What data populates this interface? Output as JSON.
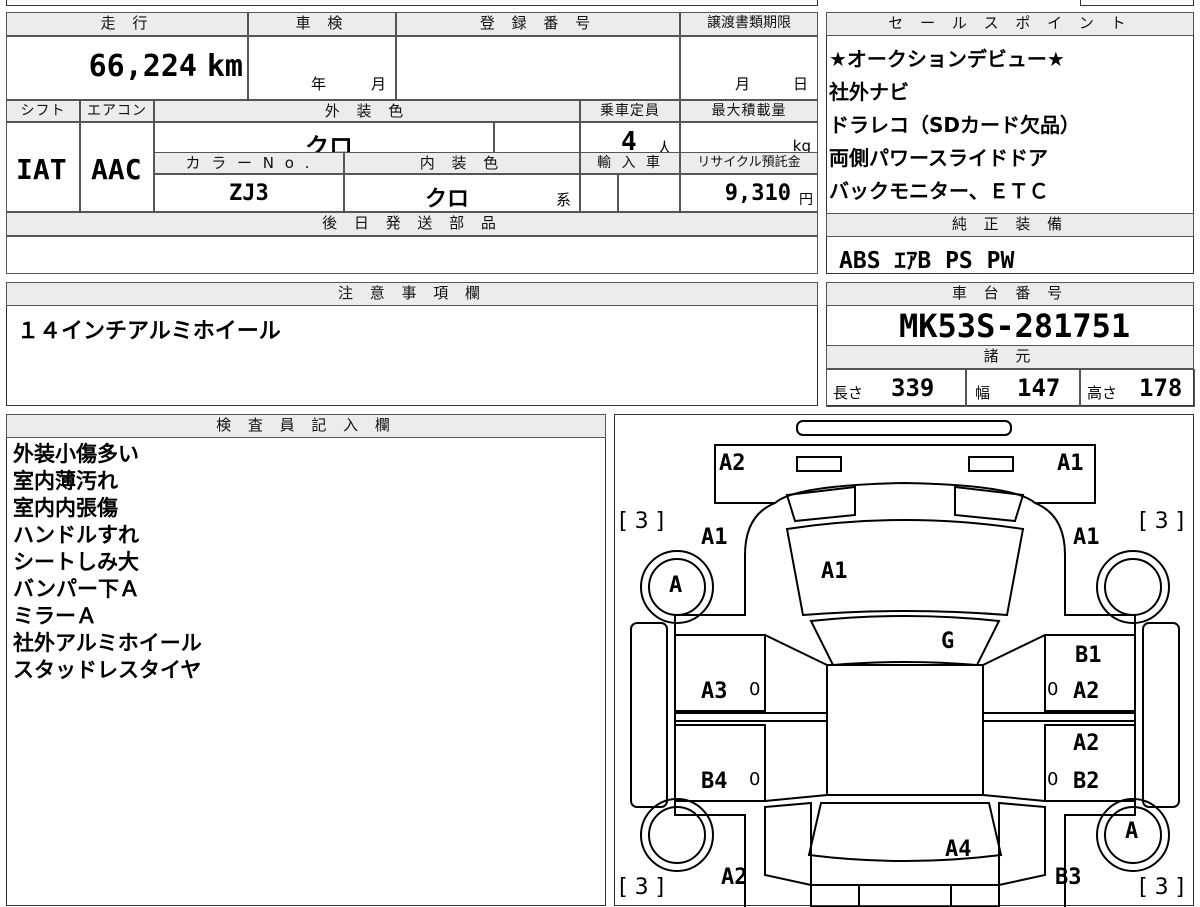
{
  "header": {
    "mileage_label": "走 行",
    "inspection_label": "車 検",
    "registration_label": "登 録 番 号",
    "transfer_deadline_label": "譲渡書類期限",
    "shift_label": "シフト",
    "aircon_label": "エアコン",
    "exterior_color_label": "外 装 色",
    "capacity_label": "乗車定員",
    "max_load_label": "最大積載量",
    "color_no_label": "カ ラ ー N o .",
    "interior_color_label": "内 装 色",
    "import_label": "輸 入 車",
    "recycle_label": "リサイクル預託金",
    "later_parts_label": "後 日 発 送 部 品",
    "notes_label": "注 意 事 項 欄",
    "sales_label": "セ ー ル ス ポ イ ン ト",
    "equipment_label": "純 正 装 備",
    "chassis_label": "車 台 番 号",
    "specs_label": "諸 元",
    "inspector_label": "検 査 員 記 入 欄"
  },
  "vehicle": {
    "mileage": "66,224",
    "mileage_unit": "km",
    "inspection_year_unit": "年",
    "inspection_month_unit": "月",
    "transfer_month_unit": "月",
    "transfer_day_unit": "日",
    "shift": "IAT",
    "aircon": "AAC",
    "exterior_color": "クロ",
    "capacity": "4",
    "capacity_unit": "人",
    "max_load_unit": "kg",
    "color_no": "ZJ3",
    "interior_color": "クロ",
    "interior_color_suffix": "系",
    "recycle_fee": "9,310",
    "recycle_unit": "円",
    "chassis_number": "MK53S-281751",
    "length_label": "長さ",
    "length": "339",
    "width_label": "幅",
    "width": "147",
    "height_label": "高さ",
    "height": "178"
  },
  "sales_points": [
    "★オークションデビュー★",
    "社外ナビ",
    "ドラレコ（SDカード欠品）",
    "両側パワースライドドア",
    "バックモニター、ＥＴＣ"
  ],
  "equipment": "ABS ｴｱB PS PW",
  "notes": "１４インチアルミホイール",
  "inspector_notes": [
    "外装小傷多い",
    "室内薄汚れ",
    "室内内張傷",
    "ハンドルすれ",
    "シートしみ大",
    "バンパー下Ａ",
    "ミラーＡ",
    "社外アルミホイール",
    "スタッドレスタイヤ"
  ],
  "damage_map": {
    "front_left_corner": "A2",
    "front_right_corner": "A1",
    "tire_tread_fl": "[ 3 ]",
    "tire_tread_fr": "[ 3 ]",
    "tire_tread_rl": "[ 3 ]",
    "tire_tread_rr": "[ 3 ]",
    "left_fender": "A1",
    "right_fender": "A1",
    "hood": "A1",
    "front_left_wheel": "A",
    "windshield": "G",
    "right_front_door_1": "B1",
    "left_front_door": "A3",
    "right_front_door_2": "A2",
    "right_rear_door_1": "A2",
    "left_rear_door": "B4",
    "right_rear_door_2": "B2",
    "rear_right_wheel": "A",
    "rear_center": "A4",
    "rear_left_quarter": "A2",
    "rear_right_quarter": "B3",
    "mark_zero": "0"
  }
}
